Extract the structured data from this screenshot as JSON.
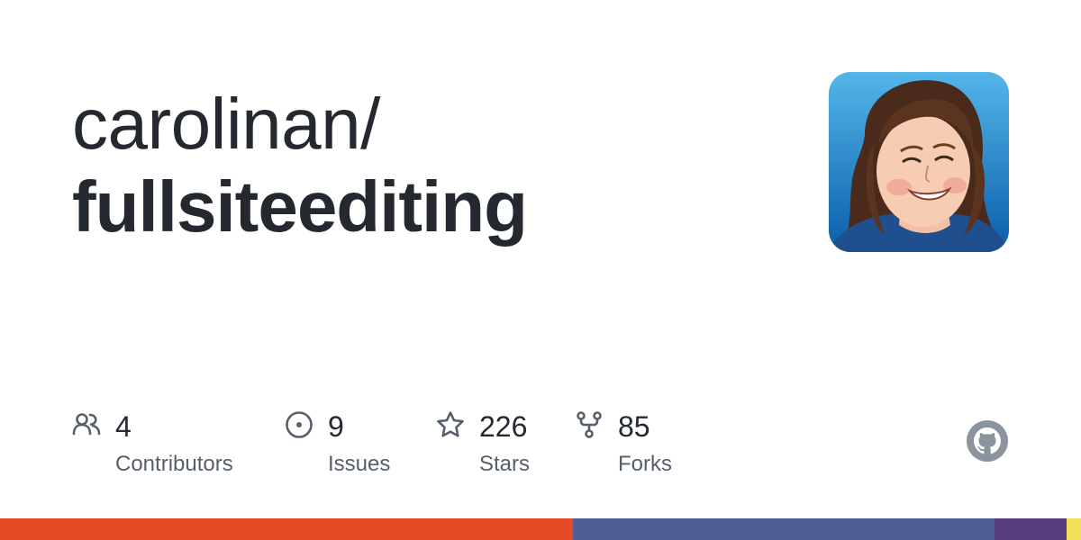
{
  "repo": {
    "owner": "carolinan/",
    "name": "fullsiteediting"
  },
  "avatar": {
    "icon": "user-avatar-illustration",
    "alt": "carolinan avatar"
  },
  "stats": [
    {
      "icon": "people-icon",
      "value": "4",
      "label": "Contributors"
    },
    {
      "icon": "issue-opened-icon",
      "value": "9",
      "label": "Issues"
    },
    {
      "icon": "star-icon",
      "value": "226",
      "label": "Stars"
    },
    {
      "icon": "repo-forked-icon",
      "value": "85",
      "label": "Forks"
    }
  ],
  "brand": {
    "icon": "github-mark-icon"
  },
  "languages": [
    {
      "color": "#e34c26",
      "share": 0.53
    },
    {
      "color": "#4f5d95",
      "share": 0.39
    },
    {
      "color": "#563d7c",
      "share": 0.067
    },
    {
      "color": "#f1e05a",
      "share": 0.013
    }
  ],
  "colors": {
    "text": "#24292f",
    "muted": "#57606a",
    "avatar_bg": "#1a7fc4"
  }
}
